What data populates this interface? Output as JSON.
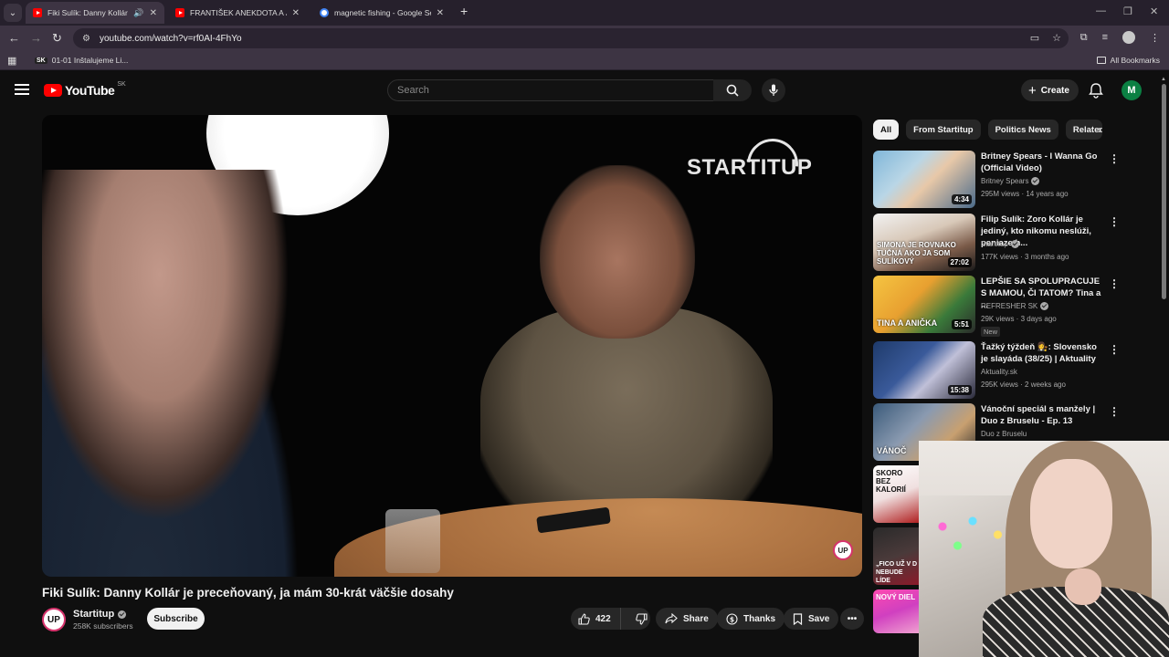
{
  "browser": {
    "tabs": [
      {
        "title": "Fiki Sulík: Danny Kollár je preceňovaný",
        "active": true,
        "favicon": "youtube-icon"
      },
      {
        "title": "FRANTIŠEK ANEKDOTA A JEHO",
        "active": false,
        "favicon": "youtube-icon"
      },
      {
        "title": "magnetic fishing - Google Search",
        "active": false,
        "favicon": "google-icon"
      }
    ],
    "url": "youtube.com/watch?v=rf0AI-4FhYo",
    "bookmarks": [
      {
        "label": "01-01 Inštalujeme Li...",
        "badge": "SK"
      }
    ],
    "all_bookmarks_label": "All Bookmarks",
    "profile_color": "#c9c9c9"
  },
  "youtube": {
    "logo_text": "YouTube",
    "country_code": "SK",
    "search_placeholder": "Search",
    "create_label": "Create",
    "avatar_letter": "M",
    "avatar_color": "#0b8043"
  },
  "video": {
    "brand_text": "STARTITUP",
    "badge_text": "UP",
    "title": "Fiki Sulík: Danny Kollár je preceňovaný, ja mám 30-krát väčšie dosahy",
    "channel": {
      "name": "Startitup",
      "subscribers": "258K subscribers",
      "avatar_text": "UP"
    },
    "subscribe_label": "Subscribe",
    "likes": "422",
    "share_label": "Share",
    "thanks_label": "Thanks",
    "save_label": "Save"
  },
  "filters": [
    "All",
    "From Startitup",
    "Politics News",
    "Related"
  ],
  "recommendations": [
    {
      "title": "Britney Spears - I Wanna Go (Official Video)",
      "channel": "Britney Spears",
      "verified": true,
      "meta": "295M views · 14 years ago",
      "duration": "4:34",
      "thumb_text": "",
      "new": false
    },
    {
      "title": "Filip Sulík: Zoro Kollár je jediný, kto nikomu neslúži, peniaze h...",
      "channel": "Startitup",
      "verified": true,
      "meta": "177K views · 3 months ago",
      "duration": "27:02",
      "thumb_text": "SIMONA JE ROVNAKO TUČNÁ AKO JA SOM SULÍKOVÝ",
      "new": false
    },
    {
      "title": "LEPŠIE SA SPOLUPRACUJE S MAMOU, ČI TATOM? Tina a ...",
      "channel": "REFRESHER SK",
      "verified": true,
      "meta": "29K views · 3 days ago",
      "duration": "5:51",
      "thumb_text": "TINA A ANIČKA",
      "new": true,
      "new_label": "New"
    },
    {
      "title": "Ťažký týždeň 👩‍⚖️: Slovensko je slayáda (38/25) | Aktuality",
      "channel": "Aktuality.sk",
      "verified": false,
      "meta": "295K views · 2 weeks ago",
      "duration": "15:38",
      "thumb_text": "",
      "new": false
    },
    {
      "title": "Vánoční speciál s manžely | Duo z Bruselu - Ep. 13",
      "channel": "Duo z Bruselu",
      "verified": false,
      "meta": "",
      "duration": "",
      "thumb_text": "VÁNOČ",
      "new": false
    }
  ],
  "partial_thumbs": [
    {
      "text": "SKORO BEZ KALORIÍ"
    },
    {
      "text": "„FICO UŽ V D NEBUDE LÍDE"
    },
    {
      "text": "NOVÝ DIEL"
    }
  ]
}
